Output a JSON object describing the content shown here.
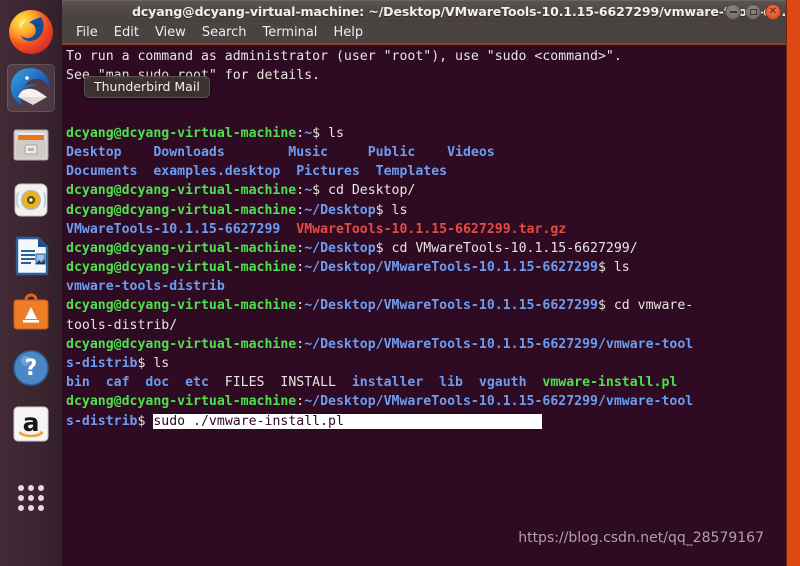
{
  "desktop": {
    "background_color": "#dd4814"
  },
  "launcher": {
    "background_color": "#3b2430",
    "items": [
      {
        "name": "firefox",
        "label": "Firefox Web Browser",
        "focused": false
      },
      {
        "name": "thunderbird",
        "label": "Thunderbird Mail",
        "focused": true
      },
      {
        "name": "files",
        "label": "Files",
        "focused": false
      },
      {
        "name": "rhythmbox",
        "label": "Rhythmbox",
        "focused": false
      },
      {
        "name": "libreoffice-writer",
        "label": "LibreOffice Writer",
        "focused": false
      },
      {
        "name": "ubuntu-software",
        "label": "Ubuntu Software",
        "focused": false
      },
      {
        "name": "help",
        "label": "Ubuntu Help",
        "focused": false
      },
      {
        "name": "amazon",
        "label": "Amazon",
        "focused": false
      }
    ],
    "dash_label": "Show Applications"
  },
  "tooltip": {
    "text": "Thunderbird Mail"
  },
  "window": {
    "title": "dcyang@dcyang-virtual-machine: ~/Desktop/VMwareTools-10.1.15-6627299/vmware-tools-d...",
    "buttons": {
      "minimize": "–",
      "maximize": "□",
      "close": "×"
    },
    "menu": [
      "File",
      "Edit",
      "View",
      "Search",
      "Terminal",
      "Help"
    ]
  },
  "terminal": {
    "background_color": "#2e0b22",
    "foreground_color": "#e8e4e1",
    "prompt_user_color": "#4fe04f",
    "prompt_path_color": "#6d9cf0",
    "selection_color": "#ffffff",
    "lines": [
      {
        "id": "l1",
        "segments": [
          {
            "text": "To run a command as administrator (user \"root\"), use \"sudo <command>\".",
            "style": "plain"
          }
        ]
      },
      {
        "id": "l2",
        "segments": [
          {
            "text": "See \"man sudo_root\" for details.",
            "style": "plain"
          }
        ]
      },
      {
        "id": "l3",
        "segments": [
          {
            "text": "",
            "style": "plain"
          }
        ]
      },
      {
        "id": "l4",
        "segments": [
          {
            "text": "",
            "style": "plain"
          }
        ]
      },
      {
        "id": "l5",
        "segments": [
          {
            "text": "dcyang@dcyang-virtual-machine",
            "style": "user"
          },
          {
            "text": ":",
            "style": "plain"
          },
          {
            "text": "~",
            "style": "path"
          },
          {
            "text": "$ ls",
            "style": "plain"
          }
        ]
      },
      {
        "id": "l6",
        "segments": [
          {
            "text": "Desktop    Downloads        Music     Public    Videos",
            "style": "dir"
          }
        ]
      },
      {
        "id": "l7",
        "segments": [
          {
            "text": "Documents  examples.desktop  Pictures  Templates",
            "style": "dir"
          }
        ]
      },
      {
        "id": "l8",
        "segments": [
          {
            "text": "dcyang@dcyang-virtual-machine",
            "style": "user"
          },
          {
            "text": ":",
            "style": "plain"
          },
          {
            "text": "~",
            "style": "path"
          },
          {
            "text": "$ cd Desktop/",
            "style": "plain"
          }
        ]
      },
      {
        "id": "l9",
        "segments": [
          {
            "text": "dcyang@dcyang-virtual-machine",
            "style": "user"
          },
          {
            "text": ":",
            "style": "plain"
          },
          {
            "text": "~/Desktop",
            "style": "path"
          },
          {
            "text": "$ ls",
            "style": "plain"
          }
        ]
      },
      {
        "id": "l10",
        "segments": [
          {
            "text": "VMwareTools-10.1.15-6627299",
            "style": "dir"
          },
          {
            "text": "  ",
            "style": "plain"
          },
          {
            "text": "VMwareTools-10.1.15-6627299.tar.gz",
            "style": "arch"
          }
        ]
      },
      {
        "id": "l11",
        "segments": [
          {
            "text": "dcyang@dcyang-virtual-machine",
            "style": "user"
          },
          {
            "text": ":",
            "style": "plain"
          },
          {
            "text": "~/Desktop",
            "style": "path"
          },
          {
            "text": "$ cd VMwareTools-10.1.15-6627299/",
            "style": "plain"
          }
        ]
      },
      {
        "id": "l12",
        "segments": [
          {
            "text": "dcyang@dcyang-virtual-machine",
            "style": "user"
          },
          {
            "text": ":",
            "style": "plain"
          },
          {
            "text": "~/Desktop/VMwareTools-10.1.15-6627299",
            "style": "path"
          },
          {
            "text": "$ ls",
            "style": "plain"
          }
        ]
      },
      {
        "id": "l13",
        "segments": [
          {
            "text": "vmware-tools-distrib",
            "style": "dir"
          }
        ]
      },
      {
        "id": "l14",
        "segments": [
          {
            "text": "dcyang@dcyang-virtual-machine",
            "style": "user"
          },
          {
            "text": ":",
            "style": "plain"
          },
          {
            "text": "~/Desktop/VMwareTools-10.1.15-6627299",
            "style": "path"
          },
          {
            "text": "$ cd vmware-",
            "style": "plain"
          }
        ]
      },
      {
        "id": "l15",
        "segments": [
          {
            "text": "tools-distrib/",
            "style": "plain"
          }
        ]
      },
      {
        "id": "l16",
        "segments": [
          {
            "text": "dcyang@dcyang-virtual-machine",
            "style": "user"
          },
          {
            "text": ":",
            "style": "plain"
          },
          {
            "text": "~/Desktop/VMwareTools-10.1.15-6627299/vmware-tool",
            "style": "path"
          }
        ]
      },
      {
        "id": "l17",
        "segments": [
          {
            "text": "s-distrib",
            "style": "path"
          },
          {
            "text": "$ ls",
            "style": "plain"
          }
        ]
      },
      {
        "id": "l18",
        "segments": [
          {
            "text": "bin  caf  doc  etc",
            "style": "dir"
          },
          {
            "text": "  FILES  INSTALL  ",
            "style": "plain"
          },
          {
            "text": "installer  lib  vgauth",
            "style": "dir"
          },
          {
            "text": "  ",
            "style": "plain"
          },
          {
            "text": "vmware-install.pl",
            "style": "exec"
          }
        ]
      },
      {
        "id": "l19",
        "segments": [
          {
            "text": "dcyang@dcyang-virtual-machine",
            "style": "user"
          },
          {
            "text": ":",
            "style": "plain"
          },
          {
            "text": "~/Desktop/VMwareTools-10.1.15-6627299/vmware-tool",
            "style": "path"
          }
        ]
      },
      {
        "id": "l20",
        "segments": [
          {
            "text": "s-distrib",
            "style": "path"
          },
          {
            "text": "$ ",
            "style": "plain"
          },
          {
            "text": "sudo ./vmware-install.pl",
            "style": "sel"
          },
          {
            "text": "                         ",
            "style": "selblank"
          }
        ]
      }
    ],
    "command_line": "sudo ./vmware-install.pl",
    "selected_text": "sudo ./vmware-install.pl"
  },
  "watermark": {
    "text": "https://blog.csdn.net/qq_28579167"
  }
}
